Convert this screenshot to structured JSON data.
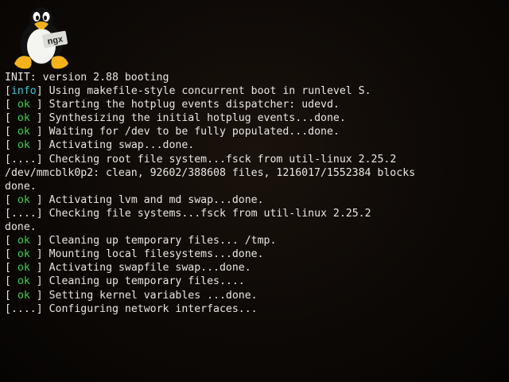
{
  "logo": {
    "icon": "tux-penguin-icon",
    "label": "ngx"
  },
  "console": {
    "lines": [
      {
        "tag": "",
        "text": "INIT: version 2.88 booting"
      },
      {
        "tag": "info",
        "text": "Using makefile-style concurrent boot in runlevel S."
      },
      {
        "tag": "ok",
        "text": "Starting the hotplug events dispatcher: udevd."
      },
      {
        "tag": "ok",
        "text": "Synthesizing the initial hotplug events...done."
      },
      {
        "tag": "ok",
        "text": "Waiting for /dev to be fully populated...done."
      },
      {
        "tag": "ok",
        "text": "Activating swap...done."
      },
      {
        "tag": "....",
        "text": "Checking root file system...fsck from util-linux 2.25.2"
      },
      {
        "tag": "",
        "text": "/dev/mmcblk0p2: clean, 92602/388608 files, 1216017/1552384 blocks"
      },
      {
        "tag": "",
        "text": "done."
      },
      {
        "tag": "ok",
        "text": "Activating lvm and md swap...done."
      },
      {
        "tag": "....",
        "text": "Checking file systems...fsck from util-linux 2.25.2"
      },
      {
        "tag": "",
        "text": "done."
      },
      {
        "tag": "ok",
        "text": "Cleaning up temporary files... /tmp."
      },
      {
        "tag": "ok",
        "text": "Mounting local filesystems...done."
      },
      {
        "tag": "ok",
        "text": "Activating swapfile swap...done."
      },
      {
        "tag": "ok",
        "text": "Cleaning up temporary files...."
      },
      {
        "tag": "ok",
        "text": "Setting kernel variables ...done."
      },
      {
        "tag": "....",
        "text": "Configuring network interfaces..."
      }
    ]
  },
  "colors": {
    "background": "#0d0906",
    "text": "#e9e6e0",
    "ok": "#38d04a",
    "info": "#38c8d8"
  }
}
